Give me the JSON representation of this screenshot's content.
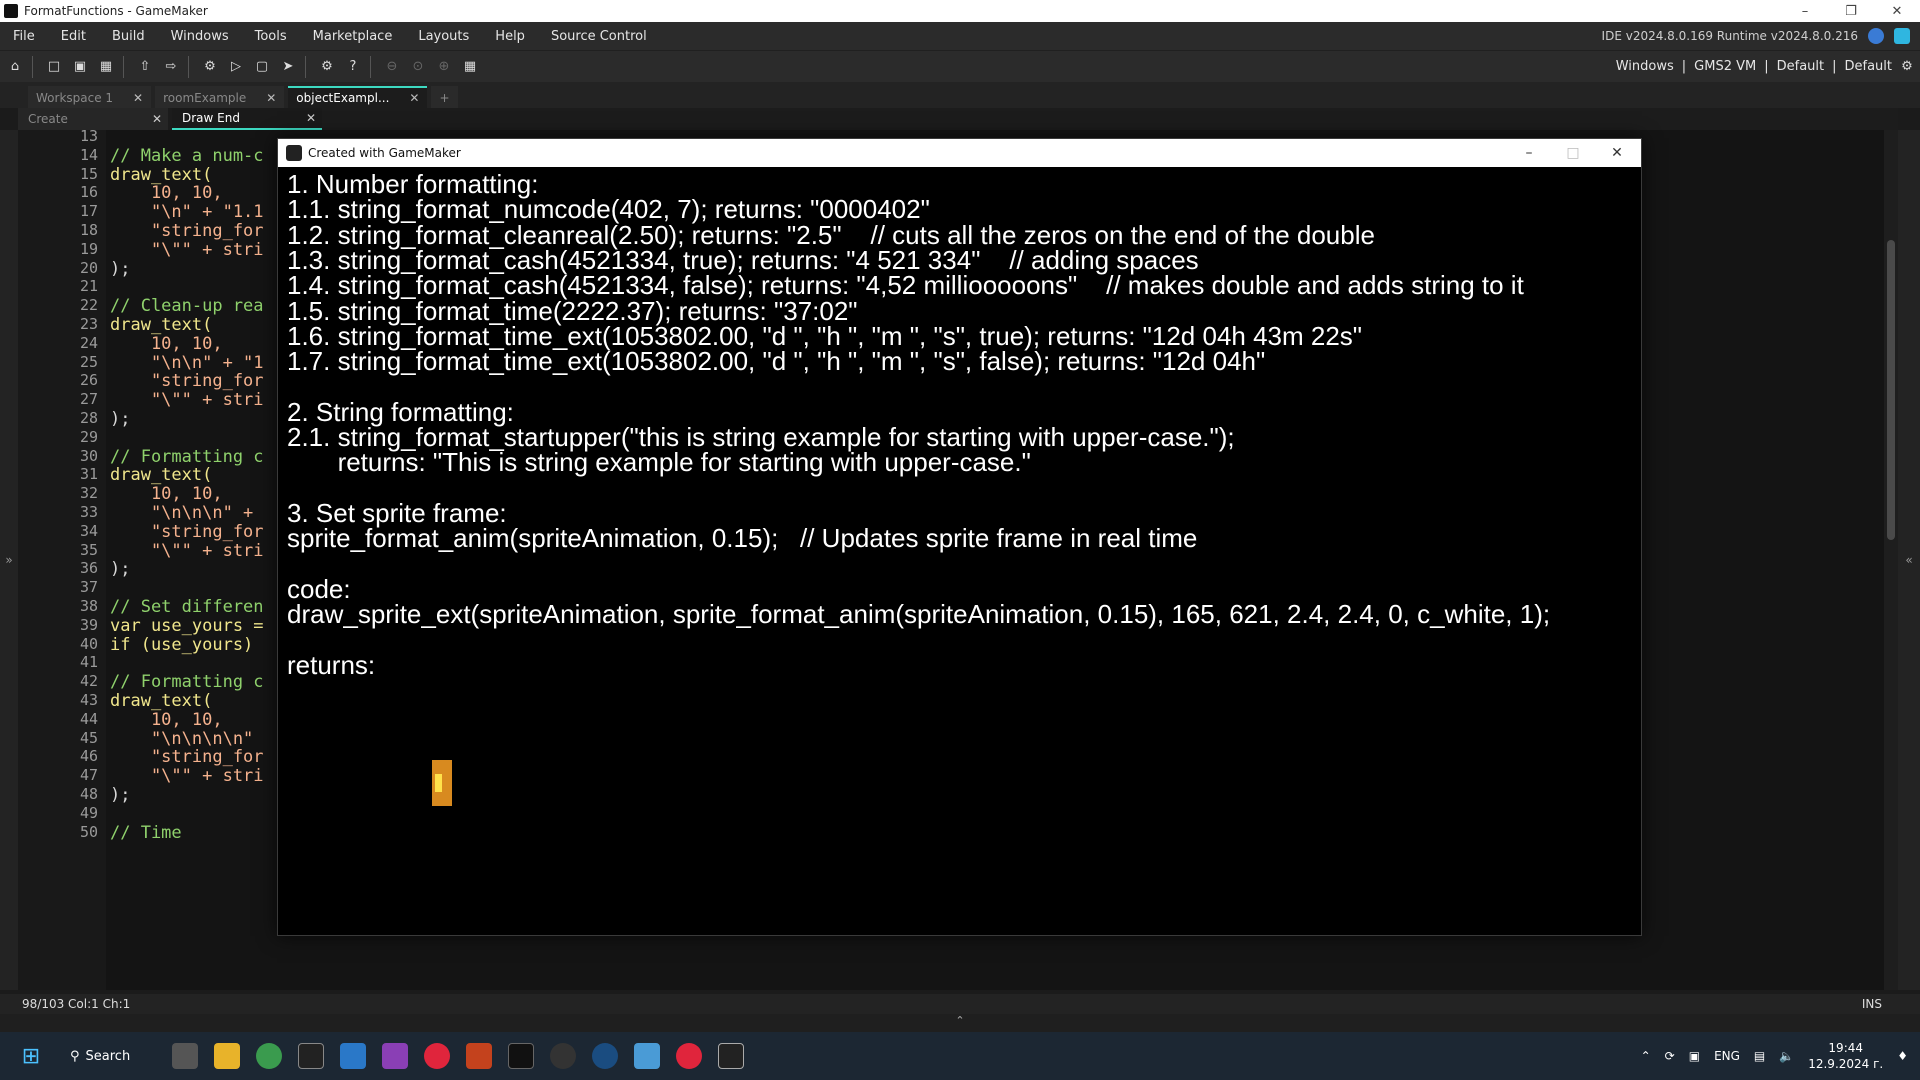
{
  "window_title": "FormatFunctions - GameMaker",
  "menu": [
    "File",
    "Edit",
    "Build",
    "Windows",
    "Tools",
    "Marketplace",
    "Layouts",
    "Help",
    "Source Control"
  ],
  "versions": "IDE v2024.8.0.169  Runtime v2024.8.0.216",
  "targets": [
    "Windows",
    "|",
    "GMS2 VM",
    "|",
    "Default",
    "|",
    "Default"
  ],
  "workspace_tabs": [
    {
      "label": "Workspace 1"
    },
    {
      "label": "roomExample"
    },
    {
      "label": "objectExampl..."
    },
    {
      "label": "+"
    }
  ],
  "editor_tabs": [
    {
      "label": "Create"
    },
    {
      "label": "Draw End"
    }
  ],
  "code_lines": [
    {
      "n": "13",
      "t": ""
    },
    {
      "n": "14",
      "t": "// Make a num-c"
    },
    {
      "n": "15",
      "t": "draw_text("
    },
    {
      "n": "16",
      "t": "    10, 10,"
    },
    {
      "n": "17",
      "t": "    \"\\n\" + \"1.1"
    },
    {
      "n": "18",
      "t": "    \"string_for"
    },
    {
      "n": "19",
      "t": "    \"\\\"\" + stri"
    },
    {
      "n": "20",
      "t": ");"
    },
    {
      "n": "21",
      "t": ""
    },
    {
      "n": "22",
      "t": "// Clean-up rea"
    },
    {
      "n": "23",
      "t": "draw_text("
    },
    {
      "n": "24",
      "t": "    10, 10,"
    },
    {
      "n": "25",
      "t": "    \"\\n\\n\" + \"1"
    },
    {
      "n": "26",
      "t": "    \"string_for"
    },
    {
      "n": "27",
      "t": "    \"\\\"\" + stri"
    },
    {
      "n": "28",
      "t": ");"
    },
    {
      "n": "29",
      "t": ""
    },
    {
      "n": "30",
      "t": "// Formatting c"
    },
    {
      "n": "31",
      "t": "draw_text("
    },
    {
      "n": "32",
      "t": "    10, 10,"
    },
    {
      "n": "33",
      "t": "    \"\\n\\n\\n\" +"
    },
    {
      "n": "34",
      "t": "    \"string_for"
    },
    {
      "n": "35",
      "t": "    \"\\\"\" + stri"
    },
    {
      "n": "36",
      "t": ");"
    },
    {
      "n": "37",
      "t": ""
    },
    {
      "n": "38",
      "t": "// Set differen"
    },
    {
      "n": "39",
      "t": "var use_yours ="
    },
    {
      "n": "40",
      "t": "if (use_yours)"
    },
    {
      "n": "41",
      "t": ""
    },
    {
      "n": "42",
      "t": "// Formatting c"
    },
    {
      "n": "43",
      "t": "draw_text("
    },
    {
      "n": "44",
      "t": "    10, 10,"
    },
    {
      "n": "45",
      "t": "    \"\\n\\n\\n\\n\""
    },
    {
      "n": "46",
      "t": "    \"string_for"
    },
    {
      "n": "47",
      "t": "    \"\\\"\" + stri"
    },
    {
      "n": "48",
      "t": ");"
    },
    {
      "n": "49",
      "t": ""
    },
    {
      "n": "50",
      "t": "// Time"
    }
  ],
  "status": {
    "position": "98/103 Col:1 Ch:1",
    "mode": "INS"
  },
  "game_window": {
    "title": "Created with GameMaker",
    "lines": [
      "1. Number formatting:",
      "1.1. string_format_numcode(402, 7); returns: \"0000402\"",
      "1.2. string_format_cleanreal(2.50); returns: \"2.5\"    // cuts all the zeros on the end of the double",
      "1.3. string_format_cash(4521334, true); returns: \"4 521 334\"    // adding spaces",
      "1.4. string_format_cash(4521334, false); returns: \"4,52 milliooooons\"    // makes double and adds string to it",
      "1.5. string_format_time(2222.37); returns: \"37:02\"",
      "1.6. string_format_time_ext(1053802.00, \"d \", \"h \", \"m \", \"s\", true); returns: \"12d 04h 43m 22s\"",
      "1.7. string_format_time_ext(1053802.00, \"d \", \"h \", \"m \", \"s\", false); returns: \"12d 04h\"",
      "",
      "2. String formatting:",
      "2.1. string_format_startupper(\"this is string example for starting with upper-case.\");",
      "       returns: \"This is string example for starting with upper-case.\"",
      "",
      "3. Set sprite frame:",
      "sprite_format_anim(spriteAnimation, 0.15);   // Updates sprite frame in real time",
      "",
      "code:",
      "draw_sprite_ext(spriteAnimation, sprite_format_anim(spriteAnimation, 0.15), 165, 621, 2.4, 2.4, 0, c_white, 1);",
      "",
      "returns:"
    ]
  },
  "taskbar": {
    "search_label": "Search",
    "lang": "ENG",
    "time": "19:44",
    "date": "12.9.2024 г."
  },
  "colors": {
    "accent": "#3dd9c1",
    "code_green": "#8fd16c",
    "code_string": "#f5b28e"
  }
}
